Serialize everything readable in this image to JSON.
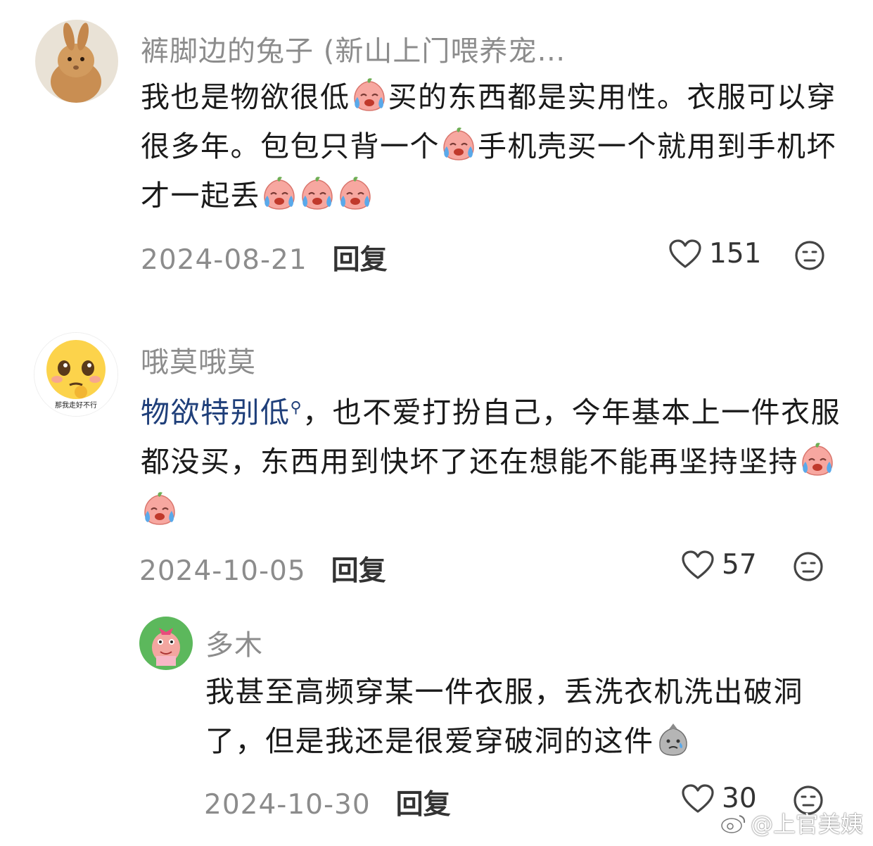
{
  "comments": [
    {
      "username": "裤脚边的兔子 (新山上门喂养宠…",
      "text_parts": [
        "我也是物欲很低",
        "买的东西都是实用性。衣服可以穿很多年。包包只背一个",
        "手机壳买一个就用到手机坏才一起丢"
      ],
      "date": "2024-08-21",
      "reply_label": "回复",
      "likes": "151"
    },
    {
      "username": "哦莫哦莫",
      "keyword": "物欲特别低",
      "text_parts": [
        "，也不爱打扮自己，今年基本上一件衣服都没买，东西用到快坏了还在想能不能再坚持坚持"
      ],
      "avatar_caption": "那我走好不行",
      "date": "2024-10-05",
      "reply_label": "回复",
      "likes": "57"
    },
    {
      "username": "多木",
      "text_parts": [
        "我甚至高频穿某一件衣服，丢洗衣机洗出破洞了，但是我还是很爱穿破洞的这件"
      ],
      "date": "2024-10-30",
      "reply_label": "回复",
      "likes": "30"
    }
  ],
  "icons": {
    "like": "heart-outline-icon",
    "react": "neutral-face-icon",
    "crying_emoji": "crying-peach-emoji",
    "sad_emoji": "sad-bag-emoji"
  },
  "watermark": "@上官美姨"
}
